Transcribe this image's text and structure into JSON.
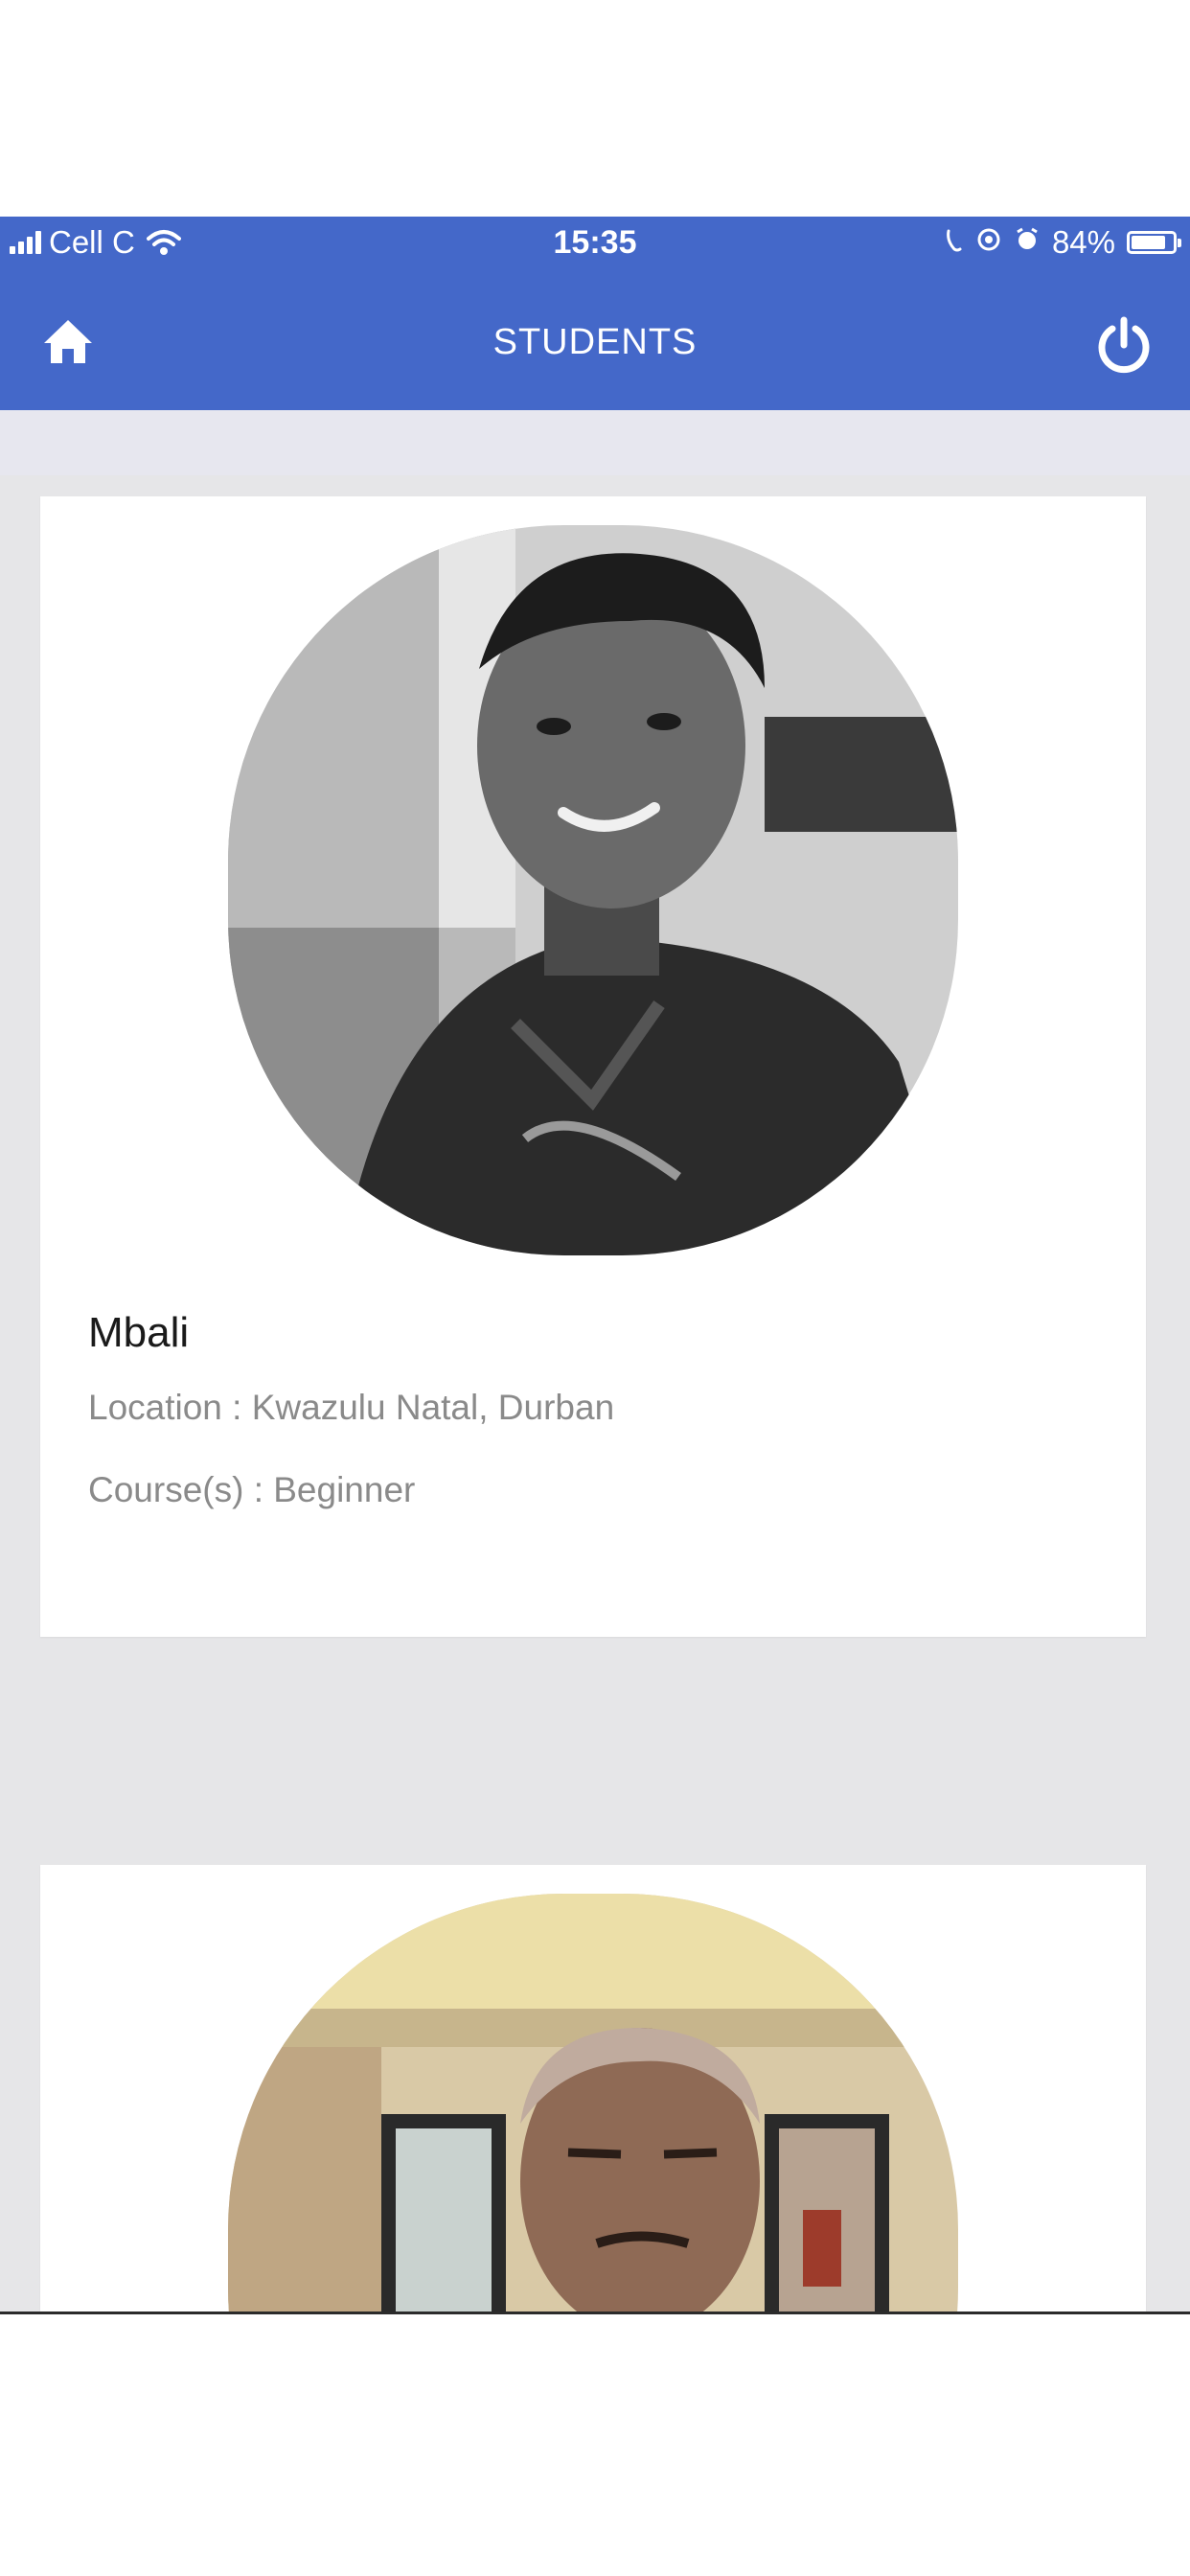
{
  "status_bar": {
    "carrier": "Cell C",
    "time": "15:35",
    "battery": "84%",
    "battery_level": 0.84
  },
  "header": {
    "title": "STUDENTS",
    "home_icon": "home-icon",
    "power_icon": "power-icon",
    "color": "#4468c9"
  },
  "students": [
    {
      "name": "Mbali",
      "location": "Location : Kwazulu Natal, Durban",
      "courses": "Course(s) : Beginner"
    }
  ]
}
